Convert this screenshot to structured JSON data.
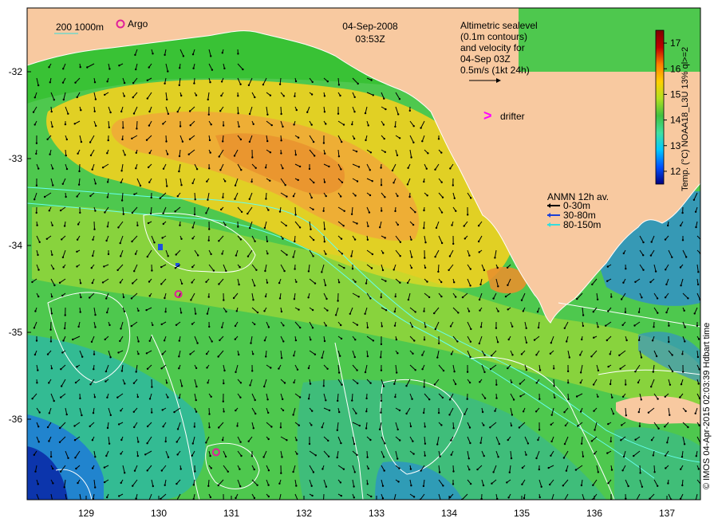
{
  "date": "04-Sep-2008",
  "time": "03:53Z",
  "scale_bar": {
    "label": "200  1000m"
  },
  "argo_legend": {
    "label": "Argo"
  },
  "altimetry_note": {
    "lines": [
      "Altimetric sealevel",
      "(0.1m contours)",
      "and velocity for",
      "04-Sep 03Z",
      "0.5m/s (1kt 24h)"
    ]
  },
  "drifter_legend": {
    "label": "drifter",
    "symbol": ">",
    "color": "#ff00ff"
  },
  "anmn_legend": {
    "title": "ANMN 12h av.",
    "items": [
      {
        "label": "0-30m",
        "color": "#000000"
      },
      {
        "label": "30-80m",
        "color": "#1a3fd6"
      },
      {
        "label": "80-150m",
        "color": "#33dddd"
      }
    ]
  },
  "colorbar": {
    "label": "Temp. (°C) NOAA18_L3U 13% ql>=2",
    "ticks": [
      "12",
      "13",
      "14",
      "15",
      "16",
      "17"
    ],
    "range": [
      11.5,
      17.5
    ],
    "colors": [
      "#00007f",
      "#0050ff",
      "#00c8ff",
      "#40e0a0",
      "#40c040",
      "#b0e020",
      "#ffd000",
      "#ff8000",
      "#c00000",
      "#7f0000"
    ]
  },
  "axes": {
    "x_ticks": [
      "129",
      "130",
      "131",
      "132",
      "133",
      "134",
      "135",
      "136",
      "137"
    ],
    "y_ticks": [
      "-32",
      "-33",
      "-34",
      "-35",
      "-36"
    ]
  },
  "argo_floats": [
    {
      "lon": 130.27,
      "lat": -34.56
    },
    {
      "lon": 130.79,
      "lat": -36.38
    }
  ],
  "credit": "© IMOS 04-Apr-2015 02:03:39 Hdbart time",
  "colors": {
    "land": "#f8c9a0",
    "contour": "#ffffff",
    "isobath": "#66ffee",
    "argo": "#e0209a"
  }
}
